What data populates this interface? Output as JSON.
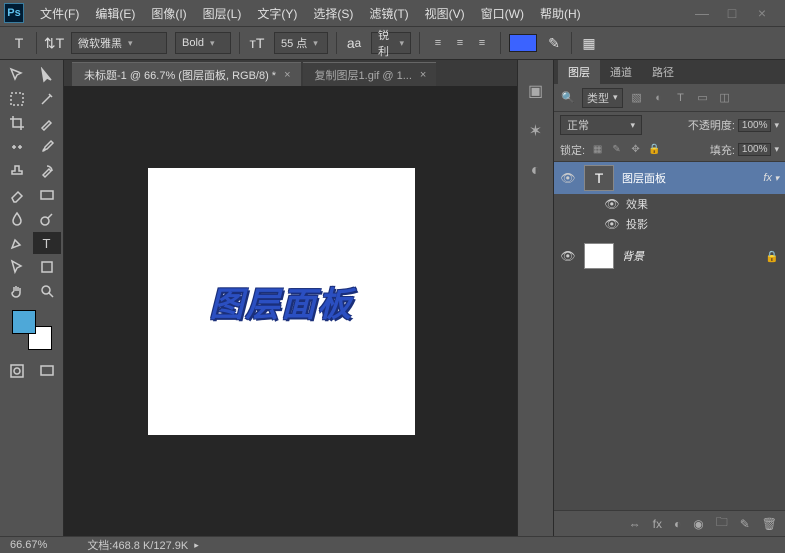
{
  "app": {
    "logo": "Ps"
  },
  "menu": {
    "items": [
      "文件(F)",
      "编辑(E)",
      "图像(I)",
      "图层(L)",
      "文字(Y)",
      "选择(S)",
      "滤镜(T)",
      "视图(V)",
      "窗口(W)",
      "帮助(H)"
    ]
  },
  "window_controls": {
    "min": "—",
    "max": "□",
    "close": "×"
  },
  "options_bar": {
    "font": "微软雅黑",
    "weight": "Bold",
    "size": "55 点",
    "aa": "锐利",
    "color": "#3b63ff"
  },
  "tabs": [
    {
      "title": "未标题-1 @ 66.7% (图层面板, RGB/8) *",
      "active": true
    },
    {
      "title": "复制图层1.gif @ 1...",
      "active": false
    }
  ],
  "canvas": {
    "text": "图层面板"
  },
  "panels": {
    "tabs": [
      "图层",
      "通道",
      "路径"
    ],
    "filter": "类型",
    "blend_mode": "正常",
    "opacity_label": "不透明度:",
    "opacity_value": "100%",
    "lock_label": "锁定:",
    "fill_label": "填充:",
    "fill_value": "100%",
    "layers": [
      {
        "name": "图层面板",
        "type": "text",
        "selected": true,
        "fx": true
      },
      {
        "name": "背景",
        "type": "bg",
        "locked": true
      }
    ],
    "fx_label": "效果",
    "fx_items": [
      "投影"
    ]
  },
  "status": {
    "zoom": "66.67%",
    "docinfo": "文档:468.8 K/127.9K"
  },
  "swatches": {
    "fg": "#4ea8d8",
    "bg": "#ffffff"
  }
}
